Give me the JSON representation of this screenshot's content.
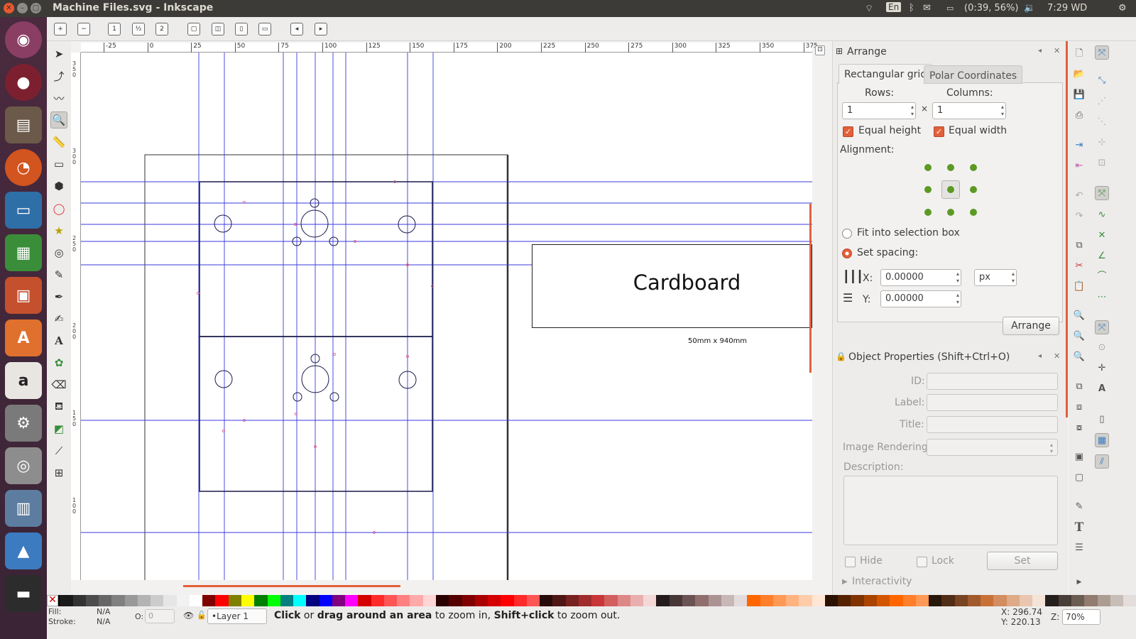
{
  "window": {
    "title": "Machine Files.svg - Inkscape"
  },
  "system_tray": {
    "keyboard": "En",
    "battery": "(0:39, 56%)",
    "clock": "7:29 WD"
  },
  "rulers": {
    "horizontal_ticks": [
      "-25",
      "0",
      "25",
      "50",
      "75",
      "100",
      "125",
      "150",
      "175",
      "200",
      "225",
      "250",
      "275",
      "300",
      "325",
      "350",
      "375"
    ],
    "vertical_ticks": [
      "3 5 0",
      "3 0 0",
      "2 5 0",
      "2 0 0",
      "1 5 0",
      "1 0 0"
    ]
  },
  "canvas": {
    "text_label": "Cardboard",
    "text_subtitle": "50mm x 940mm"
  },
  "arrange_panel": {
    "title": "Arrange",
    "tabs": [
      {
        "label": "Rectangular grid",
        "active": true
      },
      {
        "label": "Polar Coordinates",
        "active": false
      }
    ],
    "rows_label": "Rows:",
    "columns_label": "Columns:",
    "rows_value": "1",
    "columns_value": "1",
    "times": "×",
    "equal_height": "Equal height",
    "equal_width": "Equal width",
    "alignment_label": "Alignment:",
    "fit_label": "Fit into selection box",
    "set_spacing_label": "Set spacing:",
    "x_label": "X:",
    "y_label": "Y:",
    "x_value": "0.00000",
    "y_value": "0.00000",
    "unit": "px",
    "arrange_button": "Arrange"
  },
  "object_properties": {
    "title": "Object Properties (Shift+Ctrl+O)",
    "id_label": "ID:",
    "label_label": "Label:",
    "title_label": "Title:",
    "image_rendering_label": "Image Rendering:",
    "description_label": "Description:",
    "hide_label": "Hide",
    "lock_label": "Lock",
    "set_button": "Set",
    "interactivity_label": "Interactivity"
  },
  "status": {
    "fill_label": "Fill:",
    "fill_value": "N/A",
    "stroke_label": "Stroke:",
    "stroke_value": "N/A",
    "opacity_label": "O:",
    "opacity_value": "0",
    "layer": "•Layer 1",
    "message_bold1": "Click",
    "message_t1": " or ",
    "message_bold2": "drag around an area",
    "message_t2": " to zoom in, ",
    "message_bold3": "Shift+click",
    "message_t3": " to zoom out.",
    "cursor_x": "X: 296.74",
    "cursor_y": "Y: 220.13",
    "zoom_label": "Z:",
    "zoom_value": "70%"
  },
  "palette": [
    "#000000",
    "#1a1a1a",
    "#333333",
    "#4d4d4d",
    "#666666",
    "#808080",
    "#999999",
    "#b3b3b3",
    "#cccccc",
    "#e6e6e6",
    "#f2f2f2",
    "#ffffff",
    "#800000",
    "#ff0000",
    "#808000",
    "#ffff00",
    "#008000",
    "#00ff00",
    "#008080",
    "#00ffff",
    "#000080",
    "#0000ff",
    "#800080",
    "#ff00ff",
    "#d40000",
    "#ff2a2a",
    "#ff5555",
    "#ff8080",
    "#ffaaaa",
    "#ffd5d5",
    "#2b0000",
    "#550000",
    "#800000",
    "#aa0000",
    "#d40000",
    "#ff0000",
    "#ff2a2a",
    "#ff5555",
    "#280b0b",
    "#501616",
    "#782121",
    "#a02c2c",
    "#c83737",
    "#d35f5f",
    "#de8787",
    "#e9afaf",
    "#f4d7d7",
    "#241c1c",
    "#483737",
    "#6c5353",
    "#916f6f",
    "#ac9393",
    "#c8b7b7",
    "#e3dbdb",
    "#ff6600",
    "#ff7f2a",
    "#ff9955",
    "#ffb380",
    "#ffccaa",
    "#ffe6d5",
    "#2b1100",
    "#552200",
    "#803300",
    "#aa4400",
    "#d45500",
    "#ff6600",
    "#ff7f2a",
    "#ff9955",
    "#28170b",
    "#502d16",
    "#784421",
    "#a05a2c",
    "#c87137",
    "#d38d5f",
    "#deaa87",
    "#e9c6af",
    "#f4e3d7",
    "#241f1c",
    "#483e37",
    "#6c5d53",
    "#917c6f",
    "#ac9d93",
    "#c8beb7",
    "#e3dedb"
  ],
  "accent": "#e45f3b"
}
